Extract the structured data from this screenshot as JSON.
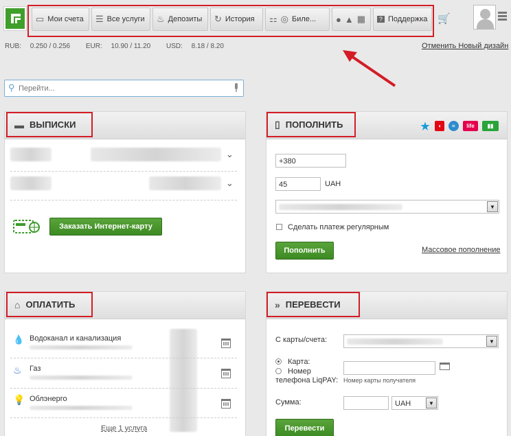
{
  "nav": {
    "items": [
      {
        "label": "Мои счета",
        "icon": "card-icon"
      },
      {
        "label": "Все услуги",
        "icon": "list-icon"
      },
      {
        "label": "Депозиты",
        "icon": "piggy-icon"
      },
      {
        "label": "История",
        "icon": "history-icon"
      },
      {
        "label": "Биле...",
        "icon": "ticket-icon"
      },
      {
        "label": "",
        "icon": "apps-icon"
      },
      {
        "label": "Поддержка",
        "icon": "question-icon"
      }
    ]
  },
  "rates": {
    "rub_label": "RUB:",
    "rub": "0.250 / 0.256",
    "eur_label": "EUR:",
    "eur": "10.90 / 11.20",
    "usd_label": "USD:",
    "usd": "8.18 / 8.20"
  },
  "cancel_design": "Отменить Новый дизайн",
  "search": {
    "placeholder": "Перейти..."
  },
  "statements": {
    "title": "ВЫПИСКИ",
    "order_card_button": "Заказать Интернет-карту"
  },
  "topup": {
    "title": "ПОПОЛНИТЬ",
    "phone": "+380",
    "amount": "45",
    "currency": "UAH",
    "regular_label": "Сделать платеж регулярным",
    "button": "Пополнить",
    "mass_link": "Массовое пополнение",
    "operators": [
      {
        "name": "star-icon",
        "color": "#1a9ad6"
      },
      {
        "name": "mts-icon",
        "color": "#e30613"
      },
      {
        "name": "kyivstar-icon",
        "color": "#2e8ccc"
      },
      {
        "name": "life-icon",
        "color": "#e5004e"
      },
      {
        "name": "utel-icon",
        "color": "#2aa33a"
      }
    ]
  },
  "pay": {
    "title": "ОПЛАТИТЬ",
    "items": [
      {
        "label": "Водоканал и канализация",
        "icon": "drop-icon"
      },
      {
        "label": "Газ",
        "icon": "flame-icon"
      },
      {
        "label": "Облэнерго",
        "icon": "bulb-icon"
      }
    ],
    "more_link": "Еще 1 услуга"
  },
  "transfer": {
    "title": "ПЕРЕВЕСТИ",
    "from_label": "С карты/счета:",
    "card_option": "Карта:",
    "phone_option_line1": "Номер",
    "phone_option_line2": "телефона LiqPAY:",
    "recipient_hint": "Номер карты получателя",
    "amount_label": "Сумма:",
    "currency": "UAH",
    "button": "Перевести"
  },
  "colors": {
    "accent_red": "#d31c25",
    "brand_green": "#3f9f2b"
  }
}
